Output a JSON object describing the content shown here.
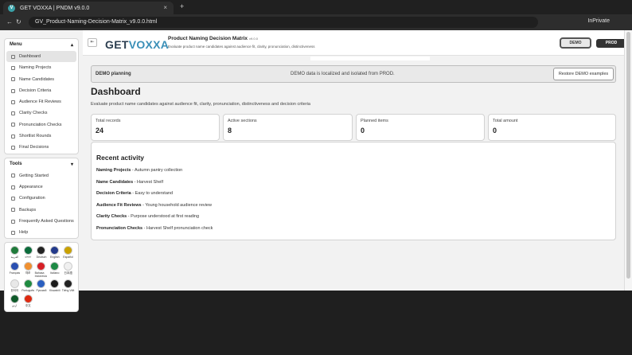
{
  "browser": {
    "tab_title": "GET VOXXA | PNDM v9.0.0",
    "favicon": "V",
    "close": "×",
    "new_tab": "+",
    "url": "GV_Product-Naming-Decision-Matrix_v9.0.0.html",
    "inprivate": "InPrivate",
    "back": "←",
    "reload": "↻"
  },
  "header": {
    "logo_get": "GET",
    "logo_voxxa": "VOXXA",
    "title": "Product Naming Decision Matrix",
    "version": "v9.0.0",
    "subtitle": "Evaluate product name candidates against audience fit, clarity, pronunciation, distinctiveness",
    "env_demo": "DEMO",
    "env_prod": "PROD",
    "collapse_icon": "⇤"
  },
  "sidebar": {
    "menu_title": "Menu",
    "menu_toggle": "▴",
    "menu_items": [
      {
        "label": "Dashboard",
        "active": true
      },
      {
        "label": "Naming Projects"
      },
      {
        "label": "Name Candidates"
      },
      {
        "label": "Decision Criteria"
      },
      {
        "label": "Audience Fit Reviews"
      },
      {
        "label": "Clarity Checks"
      },
      {
        "label": "Pronunciation Checks"
      },
      {
        "label": "Shortlist Rounds"
      },
      {
        "label": "Final Decisions"
      }
    ],
    "tools_title": "Tools",
    "tools_toggle": "▾",
    "tools_items": [
      {
        "label": "Getting Started"
      },
      {
        "label": "Appearance"
      },
      {
        "label": "Configuration"
      },
      {
        "label": "Backups"
      },
      {
        "label": "Frequently Asked Questions"
      },
      {
        "label": "Help"
      }
    ],
    "flags": [
      {
        "label": "العربية",
        "color": "#1f7a3a"
      },
      {
        "label": "বাংলা",
        "color": "#0b6b3a"
      },
      {
        "label": "Deutsch",
        "color": "#222222"
      },
      {
        "label": "English",
        "color": "#233a8b"
      },
      {
        "label": "Español",
        "color": "#c9a100"
      },
      {
        "label": "Français",
        "color": "#2a4fb0"
      },
      {
        "label": "हिंदी",
        "color": "#f09030"
      },
      {
        "label": "Bahasa Indonesia",
        "color": "#d61f26"
      },
      {
        "label": "Italiano",
        "color": "#1e8a45"
      },
      {
        "label": "日本語",
        "color": "#f0f0f0"
      },
      {
        "label": "한국어",
        "color": "#e8e8e8"
      },
      {
        "label": "Português",
        "color": "#1f8a40"
      },
      {
        "label": "Русский",
        "color": "#2a5fc0"
      },
      {
        "label": "Kiswahili",
        "color": "#1a1a1a"
      },
      {
        "label": "Tiếng Việt",
        "color": "#222222"
      },
      {
        "label": "اردو",
        "color": "#0f5a2a"
      },
      {
        "label": "中文",
        "color": "#de2910"
      }
    ]
  },
  "banner": {
    "title": "DEMO planning",
    "text": "DEMO data is localized and isolated from PROD.",
    "restore": "Restore DEMO examples"
  },
  "page": {
    "title": "Dashboard",
    "description": "Evaluate product name candidates against audience fit, clarity, pronunciation, distinctiveness and decision criteria"
  },
  "stats": [
    {
      "label": "Total records",
      "value": "24"
    },
    {
      "label": "Active sections",
      "value": "8"
    },
    {
      "label": "Planned items",
      "value": "0"
    },
    {
      "label": "Total amount",
      "value": "0"
    }
  ],
  "activity": {
    "title": "Recent activity",
    "rows": [
      {
        "section": "Naming Projects",
        "sep": " - ",
        "text": "Autumn pantry collection"
      },
      {
        "section": "Name Candidates",
        "sep": " - ",
        "text": "Harvest Shelf"
      },
      {
        "section": "Decision Criteria",
        "sep": " - ",
        "text": "Easy to understand"
      },
      {
        "section": "Audience Fit Reviews",
        "sep": " - ",
        "text": "Young household audience review"
      },
      {
        "section": "Clarity Checks",
        "sep": " - ",
        "text": "Purpose understood at first reading"
      },
      {
        "section": "Pronunciation Checks",
        "sep": " - ",
        "text": "Harvest Shelf pronunciation check"
      }
    ]
  }
}
